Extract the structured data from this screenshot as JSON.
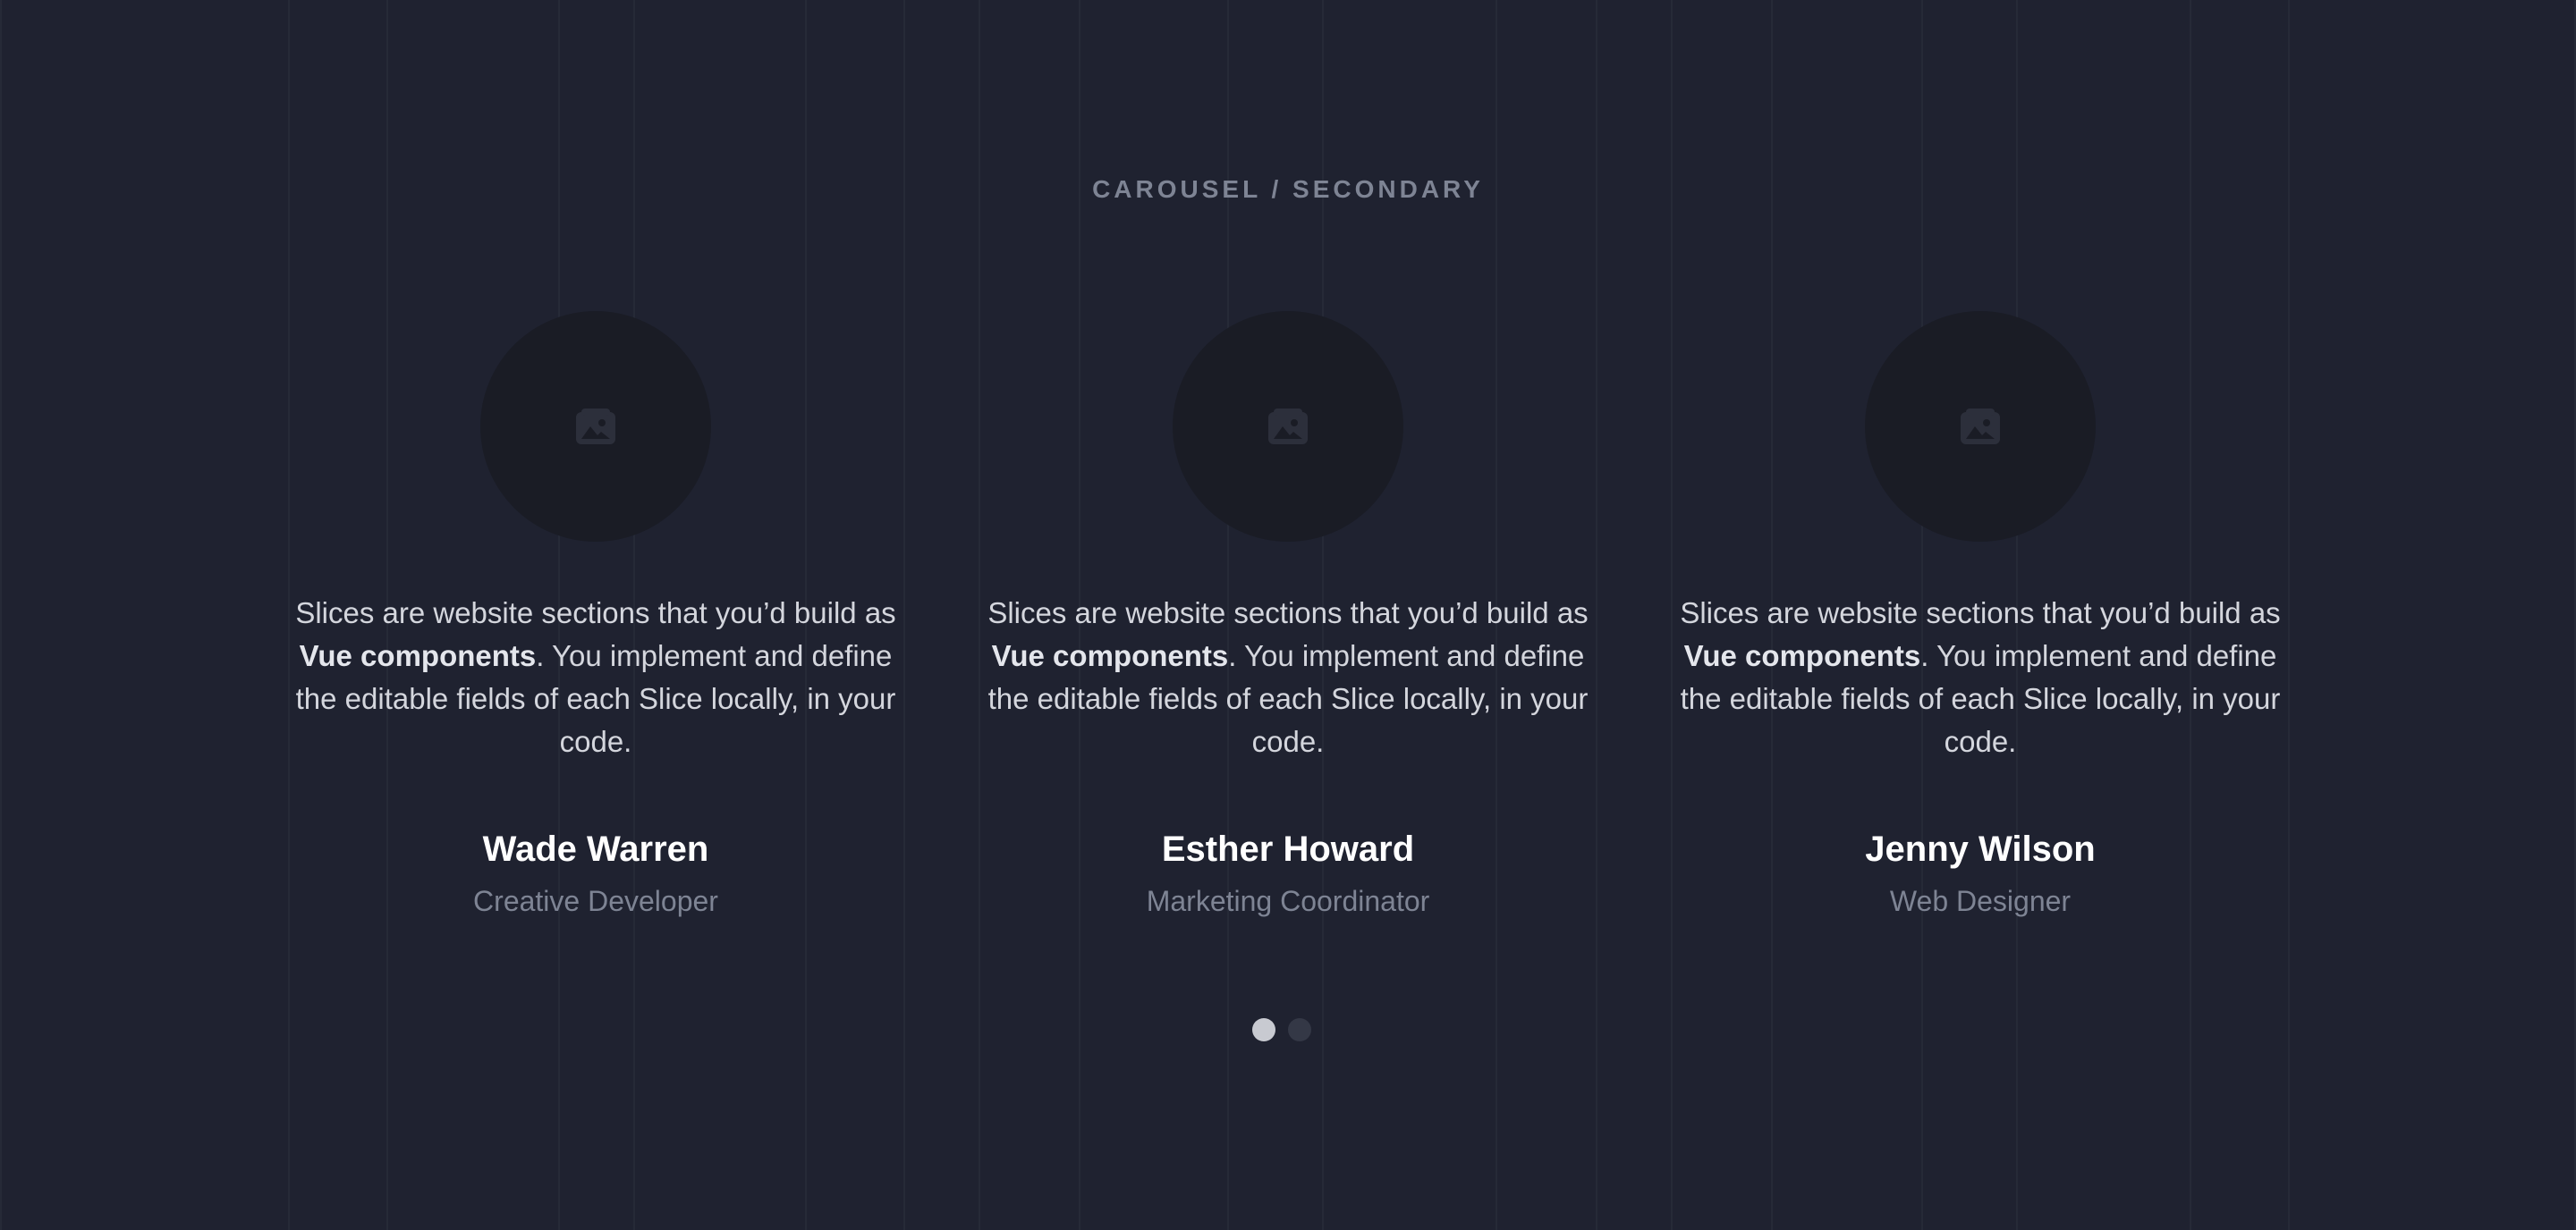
{
  "section": {
    "eyebrow": "CAROUSEL / SECONDARY"
  },
  "testimonials": [
    {
      "quote_prefix": "Slices are website sections that you’d build as ",
      "quote_bold": "Vue components",
      "quote_suffix": ". You implement and define the editable fields of each Slice locally, in your code.",
      "name": "Wade Warren",
      "role": "Creative Developer",
      "avatar_icon": "image-placeholder-icon"
    },
    {
      "quote_prefix": "Slices are website sections that you’d build as ",
      "quote_bold": "Vue components",
      "quote_suffix": ". You implement and define the editable fields of each Slice locally, in your code.",
      "name": "Esther Howard",
      "role": "Marketing Coordinator",
      "avatar_icon": "image-placeholder-icon"
    },
    {
      "quote_prefix": "Slices are website sections that you’d build as ",
      "quote_bold": "Vue components",
      "quote_suffix": ". You implement and define the editable fields of each Slice locally, in your code.",
      "name": "Jenny Wilson",
      "role": "Web Designer",
      "avatar_icon": "image-placeholder-icon"
    }
  ],
  "pagination": {
    "pages": 2,
    "active_page": 1
  },
  "colors": {
    "background": "#1f2230",
    "avatar_bg": "#1a1c25",
    "text_muted": "#7e8494",
    "text_body": "#d4d6dd",
    "dot_active": "#c8cad1",
    "dot_inactive": "#343846"
  }
}
